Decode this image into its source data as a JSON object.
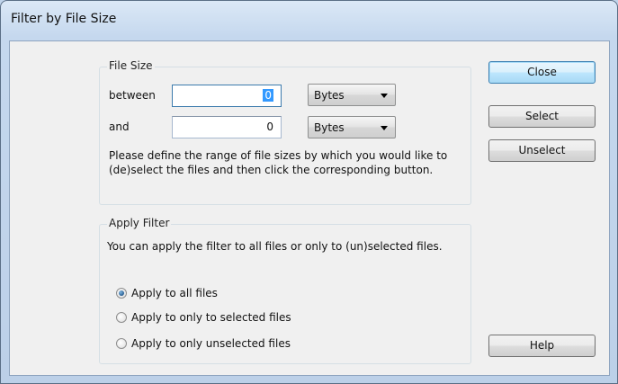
{
  "window": {
    "title": "Filter by File Size"
  },
  "file_size": {
    "legend": "File Size",
    "between_label": "between",
    "and_label": "and",
    "between_value": "0",
    "and_value": "0",
    "between_unit": "Bytes",
    "and_unit": "Bytes",
    "description": "Please define the range of file sizes by which you would like to (de)select the files and then click the corresponding button."
  },
  "apply_filter": {
    "legend": "Apply Filter",
    "description": "You can apply the filter to all files or only to (un)selected files.",
    "options": [
      {
        "label": "Apply to all files",
        "checked": true
      },
      {
        "label": "Apply to only to selected files",
        "checked": false
      },
      {
        "label": "Apply to only unselected files",
        "checked": false
      }
    ]
  },
  "buttons": {
    "close": "Close",
    "select": "Select",
    "unselect": "Unselect",
    "help": "Help"
  },
  "icons": {
    "filter": "file-filter-icon"
  }
}
